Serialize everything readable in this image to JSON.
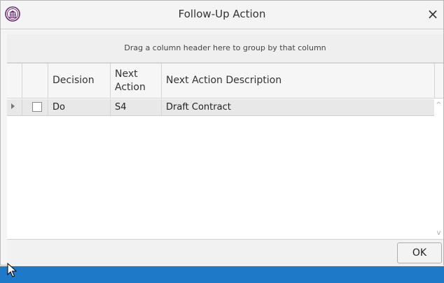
{
  "window": {
    "title": "Follow-Up Action",
    "close_symbol": "×",
    "logo_icon": "institution-logo-icon"
  },
  "group_panel": {
    "hint": "Drag a column header here to group by that column"
  },
  "grid": {
    "columns": [
      "Decision",
      "Next Action",
      "Next Action Description"
    ],
    "rows": [
      {
        "checked": false,
        "decision": "Do",
        "next_action": "S4",
        "description": "Draft Contract"
      }
    ],
    "scroll_up_symbol": "^",
    "scroll_down_symbol": "v"
  },
  "footer": {
    "ok_label": "OK"
  },
  "colors": {
    "taskbar": "#1e7ac8",
    "selected_row": "#e8e8e8"
  }
}
